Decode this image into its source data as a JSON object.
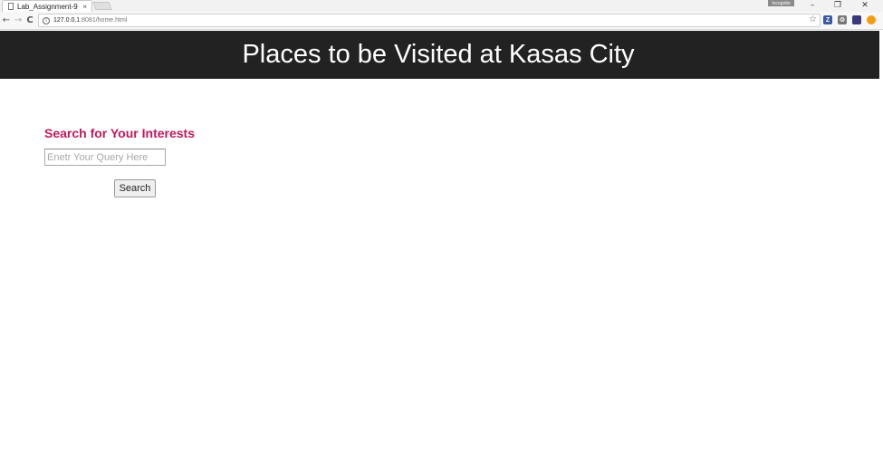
{
  "browser": {
    "tab": {
      "title": "Lab_Assignment-9",
      "close_icon": "close-icon"
    },
    "profile_badge": "Incognito",
    "window_controls": {
      "minimize": "–",
      "restore": "❐",
      "close": "✕"
    },
    "nav": {
      "back": "←",
      "forward": "→",
      "reload": "C"
    },
    "address": {
      "host": "127.0.0.1",
      "path": ":8081/home.html",
      "info_icon": "i"
    },
    "bookmark_star": "☆",
    "extensions": [
      {
        "name": "z-extension-icon",
        "label": "Z",
        "color": "#3b5ba5"
      },
      {
        "name": "recycle-extension-icon",
        "label": "♲",
        "color": "#777777"
      },
      {
        "name": "folder-extension-icon",
        "label": "",
        "color": "#3a3a7a"
      },
      {
        "name": "orange-extension-icon",
        "label": "",
        "color": "#f39c12"
      }
    ]
  },
  "page": {
    "header_title": "Places to be Visited at Kasas City",
    "search_heading": "Search for Your Interests",
    "search_input": {
      "value": "",
      "placeholder": "Enetr Your Query Here"
    },
    "search_button_label": "Search"
  }
}
